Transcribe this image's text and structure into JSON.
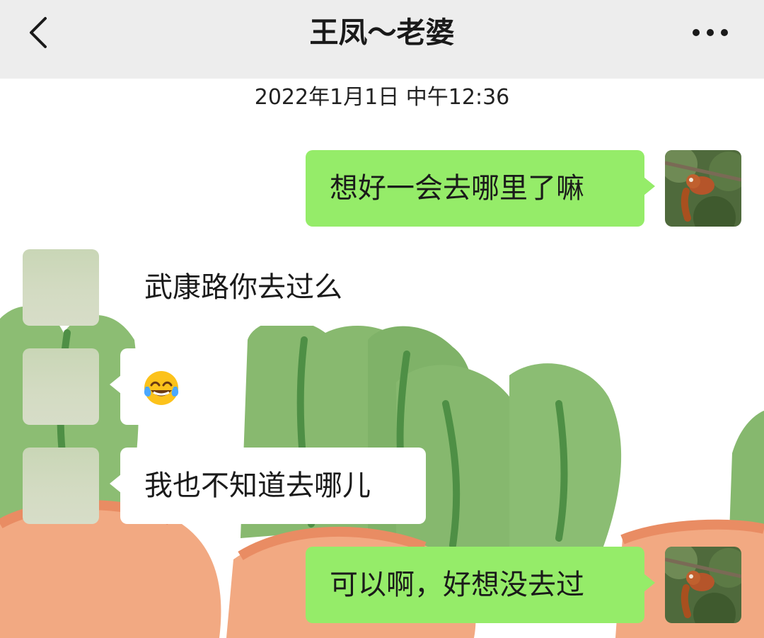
{
  "header": {
    "title": "王凤～老婆"
  },
  "timestamp": "2022年1月1日 中午12:36",
  "messages": [
    {
      "side": "me",
      "text": "想好一会去哪里了嘛"
    },
    {
      "side": "other",
      "text": "武康路你去过么"
    },
    {
      "side": "other",
      "emoji": "face-with-tears-of-joy-icon"
    },
    {
      "side": "other",
      "text": "我也不知道去哪儿"
    },
    {
      "side": "me",
      "text": "可以啊，好想没去过"
    }
  ],
  "colors": {
    "header_bg": "#ededed",
    "my_bubble": "#95ec69",
    "their_bubble": "#ffffff",
    "wallpaper_leaf": "#7fb46a",
    "wallpaper_carrot": "#f0a57d"
  }
}
